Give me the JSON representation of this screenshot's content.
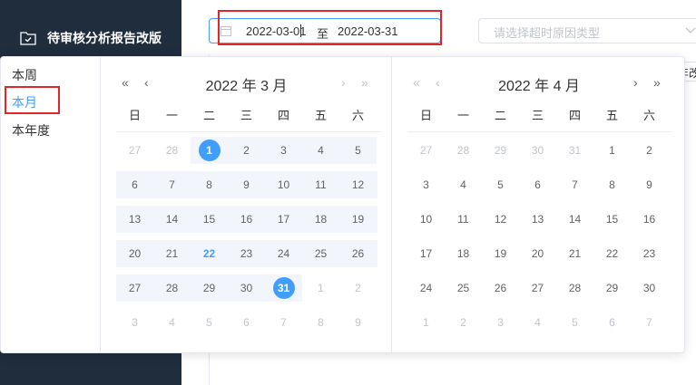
{
  "sidebar": {
    "item_label": "待审核分析报告改版"
  },
  "date_range": {
    "start": "2022-03-01",
    "separator": "至",
    "end": "2022-03-31"
  },
  "reason_select": {
    "placeholder": "请选择超时原因类型"
  },
  "toolbar": {
    "partial_text": "年改"
  },
  "shortcuts": [
    "本周",
    "本月",
    "本年度"
  ],
  "weekdays": [
    "日",
    "一",
    "二",
    "三",
    "四",
    "五",
    "六"
  ],
  "panels": [
    {
      "title": "2022 年 3 月",
      "weeks": [
        [
          {
            "d": "27",
            "o": true
          },
          {
            "d": "28",
            "o": true
          },
          {
            "d": "1",
            "s": true
          },
          {
            "d": "2"
          },
          {
            "d": "3"
          },
          {
            "d": "4"
          },
          {
            "d": "5"
          }
        ],
        [
          {
            "d": "6"
          },
          {
            "d": "7"
          },
          {
            "d": "8"
          },
          {
            "d": "9"
          },
          {
            "d": "10"
          },
          {
            "d": "11"
          },
          {
            "d": "12"
          }
        ],
        [
          {
            "d": "13"
          },
          {
            "d": "14"
          },
          {
            "d": "15"
          },
          {
            "d": "16"
          },
          {
            "d": "17"
          },
          {
            "d": "18"
          },
          {
            "d": "19"
          }
        ],
        [
          {
            "d": "20"
          },
          {
            "d": "21"
          },
          {
            "d": "22",
            "t": true
          },
          {
            "d": "23"
          },
          {
            "d": "24"
          },
          {
            "d": "25"
          },
          {
            "d": "26"
          }
        ],
        [
          {
            "d": "27"
          },
          {
            "d": "28"
          },
          {
            "d": "29"
          },
          {
            "d": "30"
          },
          {
            "d": "31",
            "s": true
          },
          {
            "d": "1",
            "o": true
          },
          {
            "d": "2",
            "o": true
          }
        ],
        [
          {
            "d": "3",
            "o": true
          },
          {
            "d": "4",
            "o": true
          },
          {
            "d": "5",
            "o": true
          },
          {
            "d": "6",
            "o": true
          },
          {
            "d": "7",
            "o": true
          },
          {
            "d": "8",
            "o": true
          },
          {
            "d": "9",
            "o": true
          }
        ]
      ]
    },
    {
      "title": "2022 年 4 月",
      "weeks": [
        [
          {
            "d": "27",
            "o": true
          },
          {
            "d": "28",
            "o": true
          },
          {
            "d": "29",
            "o": true
          },
          {
            "d": "30",
            "o": true
          },
          {
            "d": "31",
            "o": true
          },
          {
            "d": "1"
          },
          {
            "d": "2"
          }
        ],
        [
          {
            "d": "3"
          },
          {
            "d": "4"
          },
          {
            "d": "5"
          },
          {
            "d": "6"
          },
          {
            "d": "7"
          },
          {
            "d": "8"
          },
          {
            "d": "9"
          }
        ],
        [
          {
            "d": "10"
          },
          {
            "d": "11"
          },
          {
            "d": "12"
          },
          {
            "d": "13"
          },
          {
            "d": "14"
          },
          {
            "d": "15"
          },
          {
            "d": "16"
          }
        ],
        [
          {
            "d": "17"
          },
          {
            "d": "18"
          },
          {
            "d": "19"
          },
          {
            "d": "20"
          },
          {
            "d": "21"
          },
          {
            "d": "22"
          },
          {
            "d": "23"
          }
        ],
        [
          {
            "d": "24"
          },
          {
            "d": "25"
          },
          {
            "d": "26"
          },
          {
            "d": "27"
          },
          {
            "d": "28"
          },
          {
            "d": "29"
          },
          {
            "d": "30"
          }
        ],
        [
          {
            "d": "1",
            "o": true
          },
          {
            "d": "2",
            "o": true
          },
          {
            "d": "3",
            "o": true
          },
          {
            "d": "4",
            "o": true
          },
          {
            "d": "5",
            "o": true
          },
          {
            "d": "6",
            "o": true
          },
          {
            "d": "7",
            "o": true
          }
        ]
      ]
    }
  ],
  "nav_icons": {
    "prev_year": "double-chevron-left-icon",
    "prev_month": "chevron-left-icon",
    "next_month": "chevron-right-icon",
    "next_year": "double-chevron-right-icon"
  },
  "colors": {
    "accent": "#409eff",
    "sidebar_bg": "#1f2d3d",
    "annotation_red": "#e0262a",
    "range_band": "#f2f6fc"
  }
}
